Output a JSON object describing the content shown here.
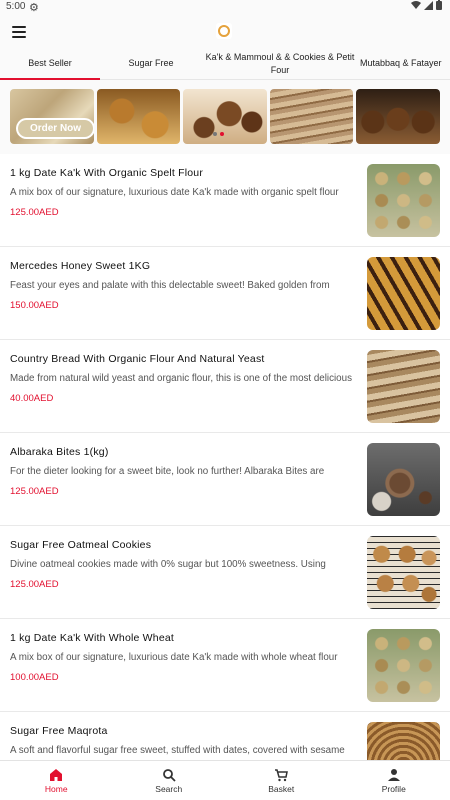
{
  "status": {
    "time": "5:00"
  },
  "tabs": [
    {
      "label": "Best Seller"
    },
    {
      "label": "Sugar Free"
    },
    {
      "label": "Ka'k & Mammoul & & Cookies & Petit Four"
    },
    {
      "label": "Mutabbaq & Fatayer"
    }
  ],
  "banner": {
    "button_label": "Order Now"
  },
  "products": [
    {
      "name": "1 kg Date Ka'k With Organic Spelt Flour",
      "description": "A mix box of our signature, luxurious date Ka'k made with organic spelt flour",
      "price": "125.00AED"
    },
    {
      "name": "Mercedes Honey Sweet 1KG",
      "description": "Feast your eyes and palate with this delectable sweet! Baked golden from",
      "price": "150.00AED"
    },
    {
      "name": "Country Bread With Organic Flour And Natural Yeast",
      "description": "Made from natural wild yeast and organic flour, this is one of the most delicious",
      "price": "40.00AED"
    },
    {
      "name": "Albaraka Bites 1(kg)",
      "description": "For the dieter looking for a sweet bite, look no further! Albaraka Bites are",
      "price": "125.00AED"
    },
    {
      "name": "Sugar Free Oatmeal Cookies",
      "description": "Divine oatmeal cookies made with 0% sugar but 100% sweetness. Using",
      "price": "125.00AED"
    },
    {
      "name": "1 kg Date Ka'k With Whole Wheat",
      "description": "A mix box of our signature, luxurious date Ka'k made with whole wheat flour",
      "price": "100.00AED"
    },
    {
      "name": "Sugar Free Maqrota",
      "description": "A soft and flavorful sugar free sweet, stuffed with dates, covered with sesame",
      "price": ""
    }
  ],
  "nav": [
    {
      "label": "Home",
      "icon": "home-icon"
    },
    {
      "label": "Search",
      "icon": "search-icon"
    },
    {
      "label": "Basket",
      "icon": "basket-icon"
    },
    {
      "label": "Profile",
      "icon": "profile-icon"
    }
  ],
  "colors": {
    "accent": "#e2102f"
  }
}
